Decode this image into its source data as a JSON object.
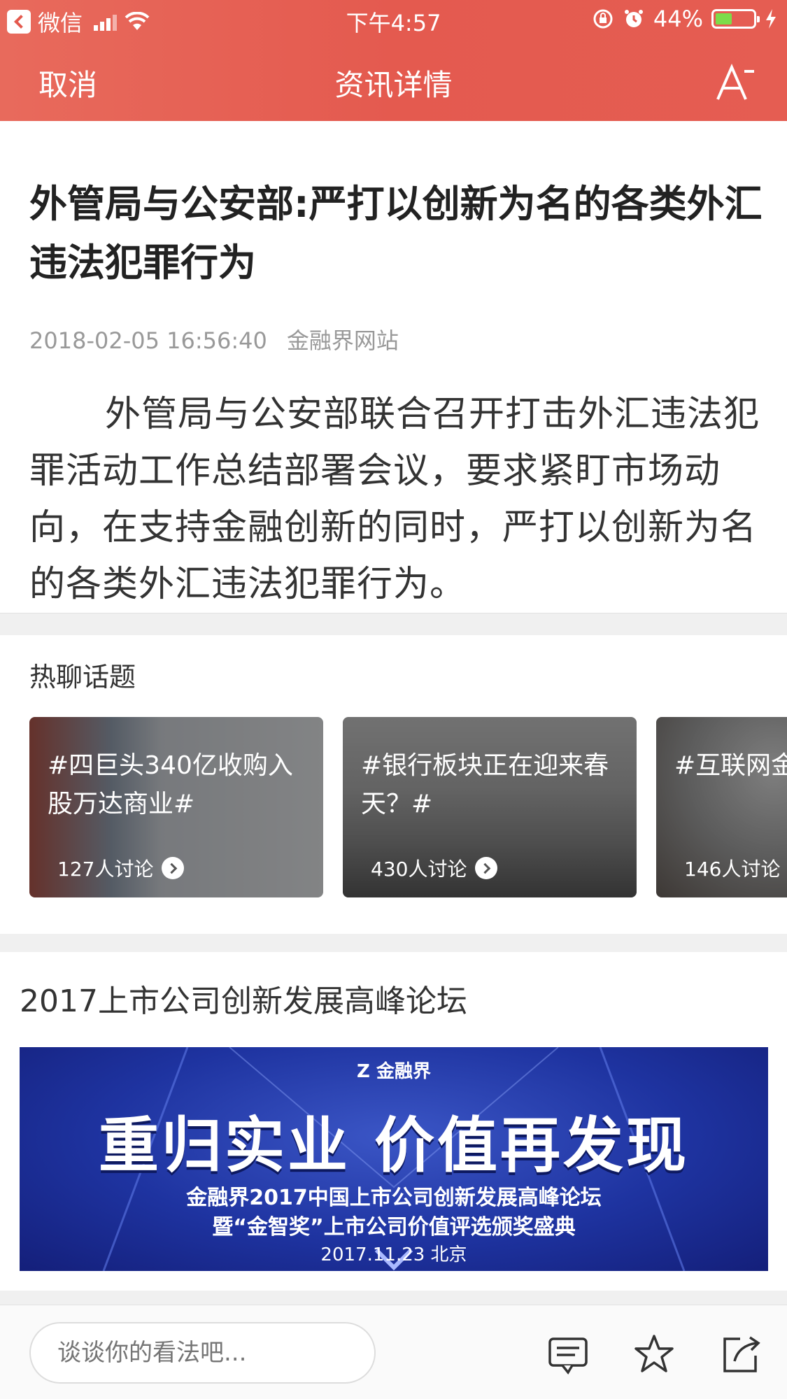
{
  "status_bar": {
    "back_app": "微信",
    "time": "下午4:57",
    "battery": "44%",
    "battery_level": 0.44
  },
  "nav": {
    "cancel": "取消",
    "title": "资讯详情",
    "font_icon": "font-size-icon"
  },
  "article": {
    "title": "外管局与公安部:严打以创新为名的各类外汇违法犯罪行为",
    "date": "2018-02-05 16:56:40",
    "source": "金融界网站",
    "summary": "外管局与公安部联合召开打击外汇违法犯罪活动工作总结部署会议，要求紧盯市场动向，在支持金融创新的同时，严打以创新为名的各类外汇违法犯罪行为。"
  },
  "hot_topics": {
    "title": "热聊话题",
    "items": [
      {
        "title": "#四巨头340亿收购入股万达商业#",
        "count": "127人讨论"
      },
      {
        "title": "#银行板块正在迎来春天？#",
        "count": "430人讨论"
      },
      {
        "title": "#互联网金融发#",
        "count": "146人讨论"
      }
    ]
  },
  "forum": {
    "title": "2017上市公司创新发展高峰论坛",
    "banner": {
      "logo": "Z 金融界",
      "headline": "重归实业 价值再发现",
      "line1": "金融界2017中国上市公司创新发展高峰论坛",
      "line2": "暨“金智奖”上市公司价值评选颁奖盛典",
      "line3": "2017.11.23 北京"
    }
  },
  "bottom_bar": {
    "comment_placeholder": "谈谈你的看法吧...",
    "icons": [
      "comment-icon",
      "star-icon",
      "share-icon"
    ]
  },
  "colors": {
    "header": "#e45a4f",
    "banner": "#1e33a0"
  }
}
